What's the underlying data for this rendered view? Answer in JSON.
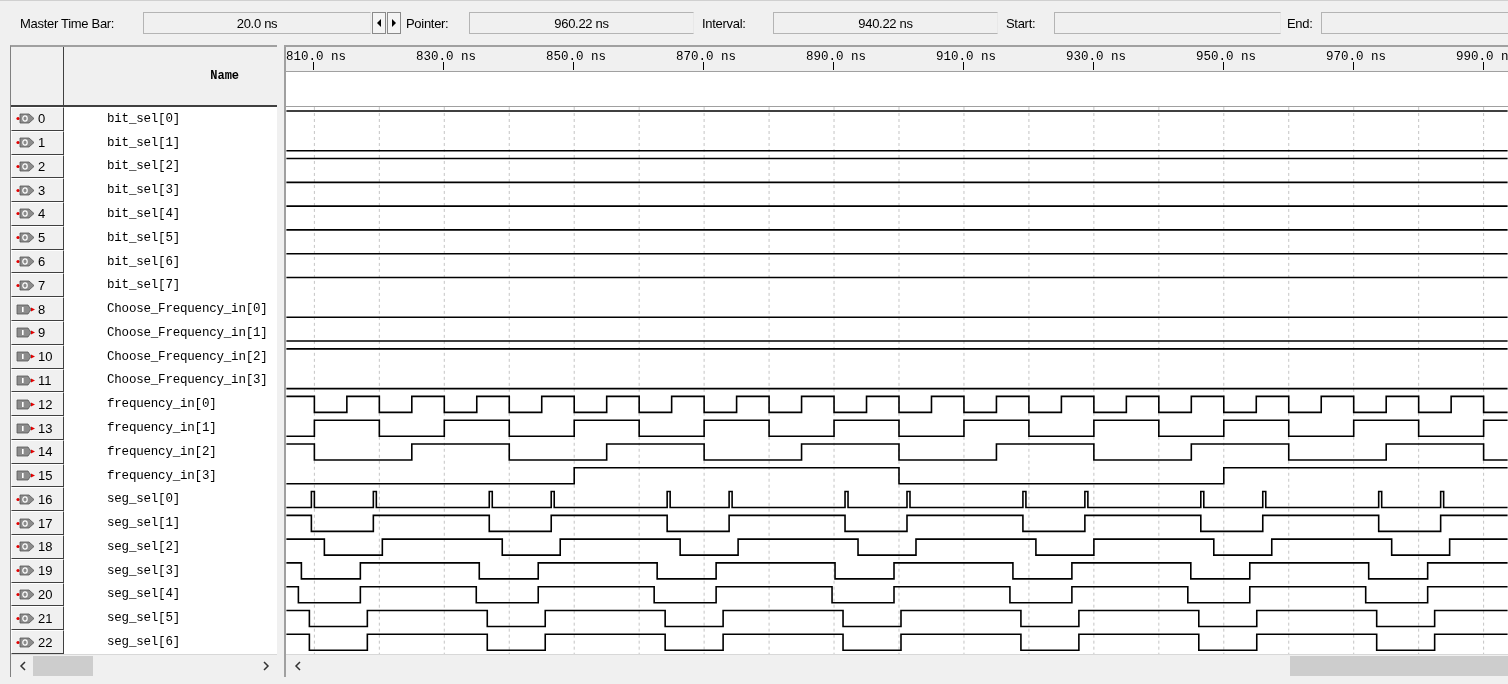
{
  "toolbar": {
    "fields": [
      {
        "label": "Master Time Bar:",
        "value": "20.0 ns"
      },
      {
        "label": "Pointer:",
        "value": "960.22 ns"
      },
      {
        "label": "Interval:",
        "value": "940.22 ns"
      },
      {
        "label": "Start:"
      },
      {
        "label": "End:"
      }
    ]
  },
  "name_header": "Name",
  "time_ruler": [
    "810.0 ns",
    "830.0 ns",
    "850.0 ns",
    "870.0 ns",
    "890.0 ns",
    "910.0 ns",
    "930.0 ns",
    "950.0 ns",
    "970.0 ns",
    "990.0 n"
  ],
  "signals": [
    {
      "index": "0",
      "kind": "output",
      "name": "bit_sel[0]"
    },
    {
      "index": "1",
      "kind": "output",
      "name": "bit_sel[1]"
    },
    {
      "index": "2",
      "kind": "output",
      "name": "bit_sel[2]"
    },
    {
      "index": "3",
      "kind": "output",
      "name": "bit_sel[3]"
    },
    {
      "index": "4",
      "kind": "output",
      "name": "bit_sel[4]"
    },
    {
      "index": "5",
      "kind": "output",
      "name": "bit_sel[5]"
    },
    {
      "index": "6",
      "kind": "output",
      "name": "bit_sel[6]"
    },
    {
      "index": "7",
      "kind": "output",
      "name": "bit_sel[7]"
    },
    {
      "index": "8",
      "kind": "input",
      "name": "Choose_Frequency_in[0]"
    },
    {
      "index": "9",
      "kind": "input",
      "name": "Choose_Frequency_in[1]"
    },
    {
      "index": "10",
      "kind": "input",
      "name": "Choose_Frequency_in[2]"
    },
    {
      "index": "11",
      "kind": "input",
      "name": "Choose_Frequency_in[3]"
    },
    {
      "index": "12",
      "kind": "input",
      "name": "frequency_in[0]"
    },
    {
      "index": "13",
      "kind": "input",
      "name": "frequency_in[1]"
    },
    {
      "index": "14",
      "kind": "input",
      "name": "frequency_in[2]"
    },
    {
      "index": "15",
      "kind": "input",
      "name": "frequency_in[3]"
    },
    {
      "index": "16",
      "kind": "output",
      "name": "seg_sel[0]"
    },
    {
      "index": "17",
      "kind": "output",
      "name": "seg_sel[1]"
    },
    {
      "index": "18",
      "kind": "output",
      "name": "seg_sel[2]"
    },
    {
      "index": "19",
      "kind": "output",
      "name": "seg_sel[3]"
    },
    {
      "index": "20",
      "kind": "output",
      "name": "seg_sel[4]"
    },
    {
      "index": "21",
      "kind": "output",
      "name": "seg_sel[5]"
    },
    {
      "index": "22",
      "kind": "output",
      "name": "seg_sel[6]"
    }
  ]
}
